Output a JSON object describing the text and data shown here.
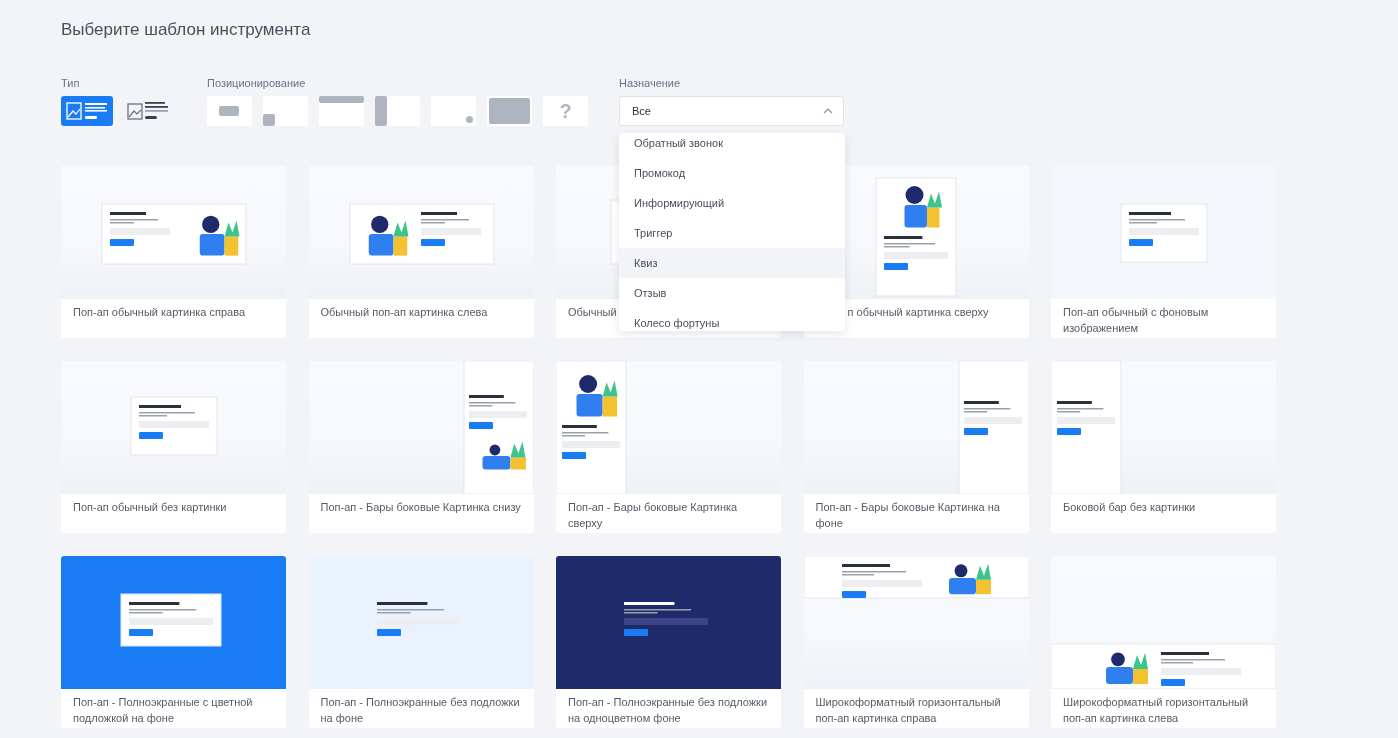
{
  "title": "Выберите шаблон инструмента",
  "type_filter": {
    "label": "Тип",
    "options": [
      {
        "kind": "image-lines",
        "selected": true
      },
      {
        "kind": "image-lines-alt",
        "selected": false
      }
    ]
  },
  "position_filter": {
    "label": "Позиционирование",
    "options": [
      {
        "kind": "center",
        "selected": false
      },
      {
        "kind": "bottom-left",
        "selected": false
      },
      {
        "kind": "top",
        "selected": false
      },
      {
        "kind": "left",
        "selected": false
      },
      {
        "kind": "bottom-right",
        "selected": false
      },
      {
        "kind": "full",
        "selected": false
      },
      {
        "kind": "help",
        "label": "?",
        "selected": false
      }
    ]
  },
  "purpose_filter": {
    "label": "Назначение",
    "value": "Все",
    "expanded": true,
    "options": [
      {
        "label": "Обратный звонок",
        "selected": false
      },
      {
        "label": "Промокод",
        "selected": false
      },
      {
        "label": "Информирующий",
        "selected": false
      },
      {
        "label": "Триггер",
        "selected": false
      },
      {
        "label": "Квиз",
        "selected": true
      },
      {
        "label": "Отзыв",
        "selected": false
      },
      {
        "label": "Колесо фортуны",
        "selected": false
      }
    ]
  },
  "templates": [
    {
      "caption": "Поп-ап обычный картинка справа"
    },
    {
      "caption": "Обычный поп-ап картинка слева"
    },
    {
      "caption": "Обычный",
      "cut_start": false
    },
    {
      "caption": "п обычный картинка сверху",
      "cut_start": true
    },
    {
      "caption": "Поп-ап обычный с фоновым изображением"
    },
    {
      "caption": "Поп-ап обычный без картинки"
    },
    {
      "caption": "Поп-ап - Бары боковые Картинка снизу"
    },
    {
      "caption": "Поп-ап - Бары боковые Картинка сверху"
    },
    {
      "caption": "Поп-ап - Бары боковые Картинка на фоне"
    },
    {
      "caption": "Боковой бар без картинки"
    },
    {
      "caption": "Поп-ап - Полноэкранные с цветной подложкой на фоне"
    },
    {
      "caption": "Поп-ап - Полноэкранные без подложки на фоне"
    },
    {
      "caption": "Поп-ап - Полноэкранные без подложки на одноцветном фоне"
    },
    {
      "caption": "Широкоформатный горизонтальный поп-ап картинка справа"
    },
    {
      "caption": "Широкоформатный горизонтальный поп-ап картинка слева"
    }
  ]
}
